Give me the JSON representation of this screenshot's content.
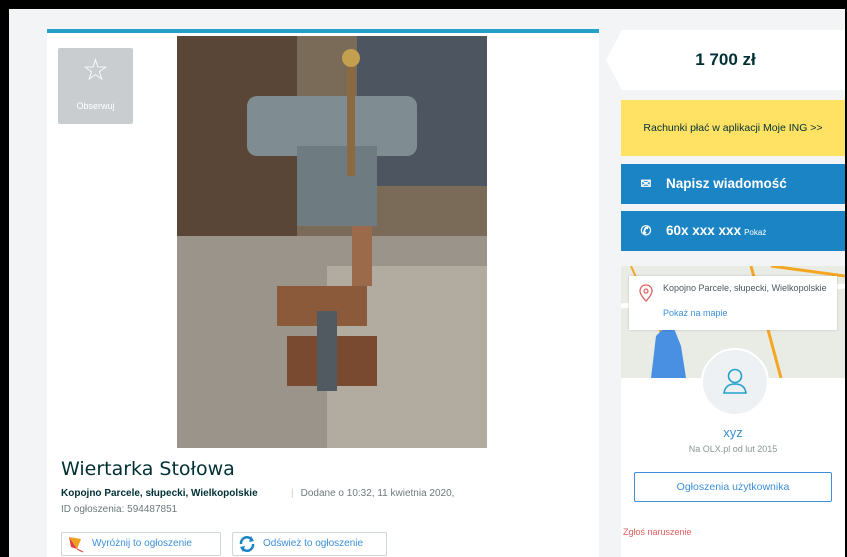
{
  "listing": {
    "observe_label": "Obserwuj",
    "title": "Wiertarka Stołowa",
    "location": "Kopojno Parcele, słupecki, Wielkopolskie",
    "added": "Dodane o 10:32, 11 kwietnia 2020,",
    "ad_id": "ID ogłoszenia: 594487851",
    "promote_label": "Wyróżnij to ogłoszenie",
    "refresh_label": "Odśwież to ogłoszenie"
  },
  "sidebar": {
    "price": "1 700 zł",
    "ing_banner": "Rachunki płać w aplikacji Moje ING >>",
    "message_button": "Napisz wiadomość",
    "phone_number": "60x xxx xxx",
    "phone_show": "Pokaż",
    "map_address": "Kopojno Parcele, słupecki, Wielkopolskie",
    "map_link": "Pokaż na mapie",
    "username": "xyz",
    "member_since": "Na OLX.pl od lut 2015",
    "user_ads_button": "Ogłoszenia użytkownika",
    "report": "Zgłoś naruszenie"
  },
  "icons": {
    "star": "star-icon",
    "envelope": "envelope-icon",
    "phone": "phone-icon",
    "pin": "map-pin-icon",
    "user": "user-icon"
  },
  "colors": {
    "accent": "#1b84c5",
    "top_border": "#23a0c9",
    "ing": "#ffe264",
    "report": "#e06060"
  }
}
